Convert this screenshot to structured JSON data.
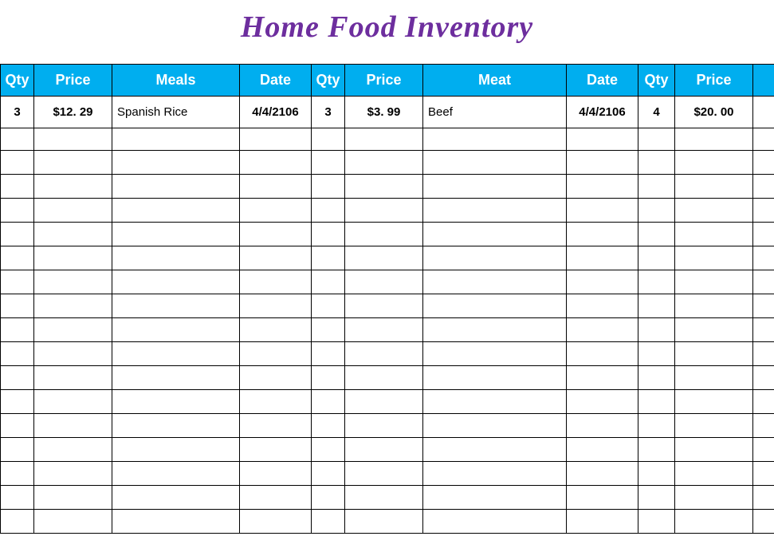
{
  "title": "Home Food Inventory",
  "headers": {
    "qty1": "Qty",
    "price1": "Price",
    "meals": "Meals",
    "date1": "Date",
    "qty2": "Qty",
    "price2": "Price",
    "meat": "Meat",
    "date2": "Date",
    "qty3": "Qty",
    "price3": "Price"
  },
  "row1": {
    "qty1": "3",
    "price1": "$12. 29",
    "meals": "Spanish Rice",
    "date1": "4/4/2106",
    "qty2": "3",
    "price2": "$3. 99",
    "meat": "Beef",
    "date2": "4/4/2106",
    "qty3": "4",
    "price3": "$20. 00"
  }
}
